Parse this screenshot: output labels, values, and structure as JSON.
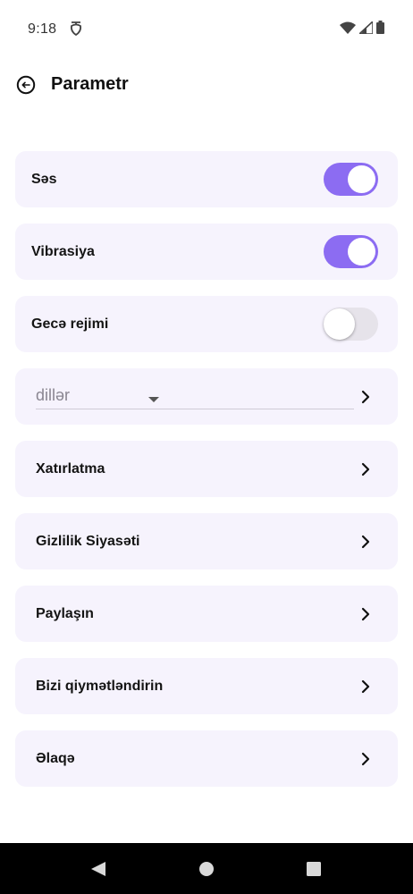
{
  "status_bar": {
    "time": "9:18",
    "notification_icon": "app-notification-icon",
    "icons": [
      "wifi-icon",
      "cellular-signal-icon",
      "battery-icon"
    ]
  },
  "header": {
    "title": "Parametr",
    "back_icon": "back-arrow-icon"
  },
  "settings": {
    "sound": {
      "label": "Səs",
      "enabled": true
    },
    "vibration": {
      "label": "Vibrasiya",
      "enabled": true
    },
    "night_mode": {
      "label": "Gecə rejimi",
      "enabled": false
    },
    "language": {
      "selected": "dillər",
      "caret_icon": "caret-down-icon"
    },
    "reminder": {
      "label": "Xatırlatma"
    },
    "privacy_policy": {
      "label": "Gizlilik Siyasəti"
    },
    "share": {
      "label": "Paylaşın"
    },
    "rate_us": {
      "label": "Bizi qiymətləndirin"
    },
    "contact": {
      "label": "Əlaqə"
    }
  },
  "nav_bar": {
    "icons": [
      "back-triangle-icon",
      "home-circle-icon",
      "recents-square-icon"
    ]
  },
  "colors": {
    "accent": "#8c6cf2",
    "card_background": "#f6f3fd",
    "toggle_off_track": "#e6e3ea",
    "nav_bar": "#000000"
  }
}
